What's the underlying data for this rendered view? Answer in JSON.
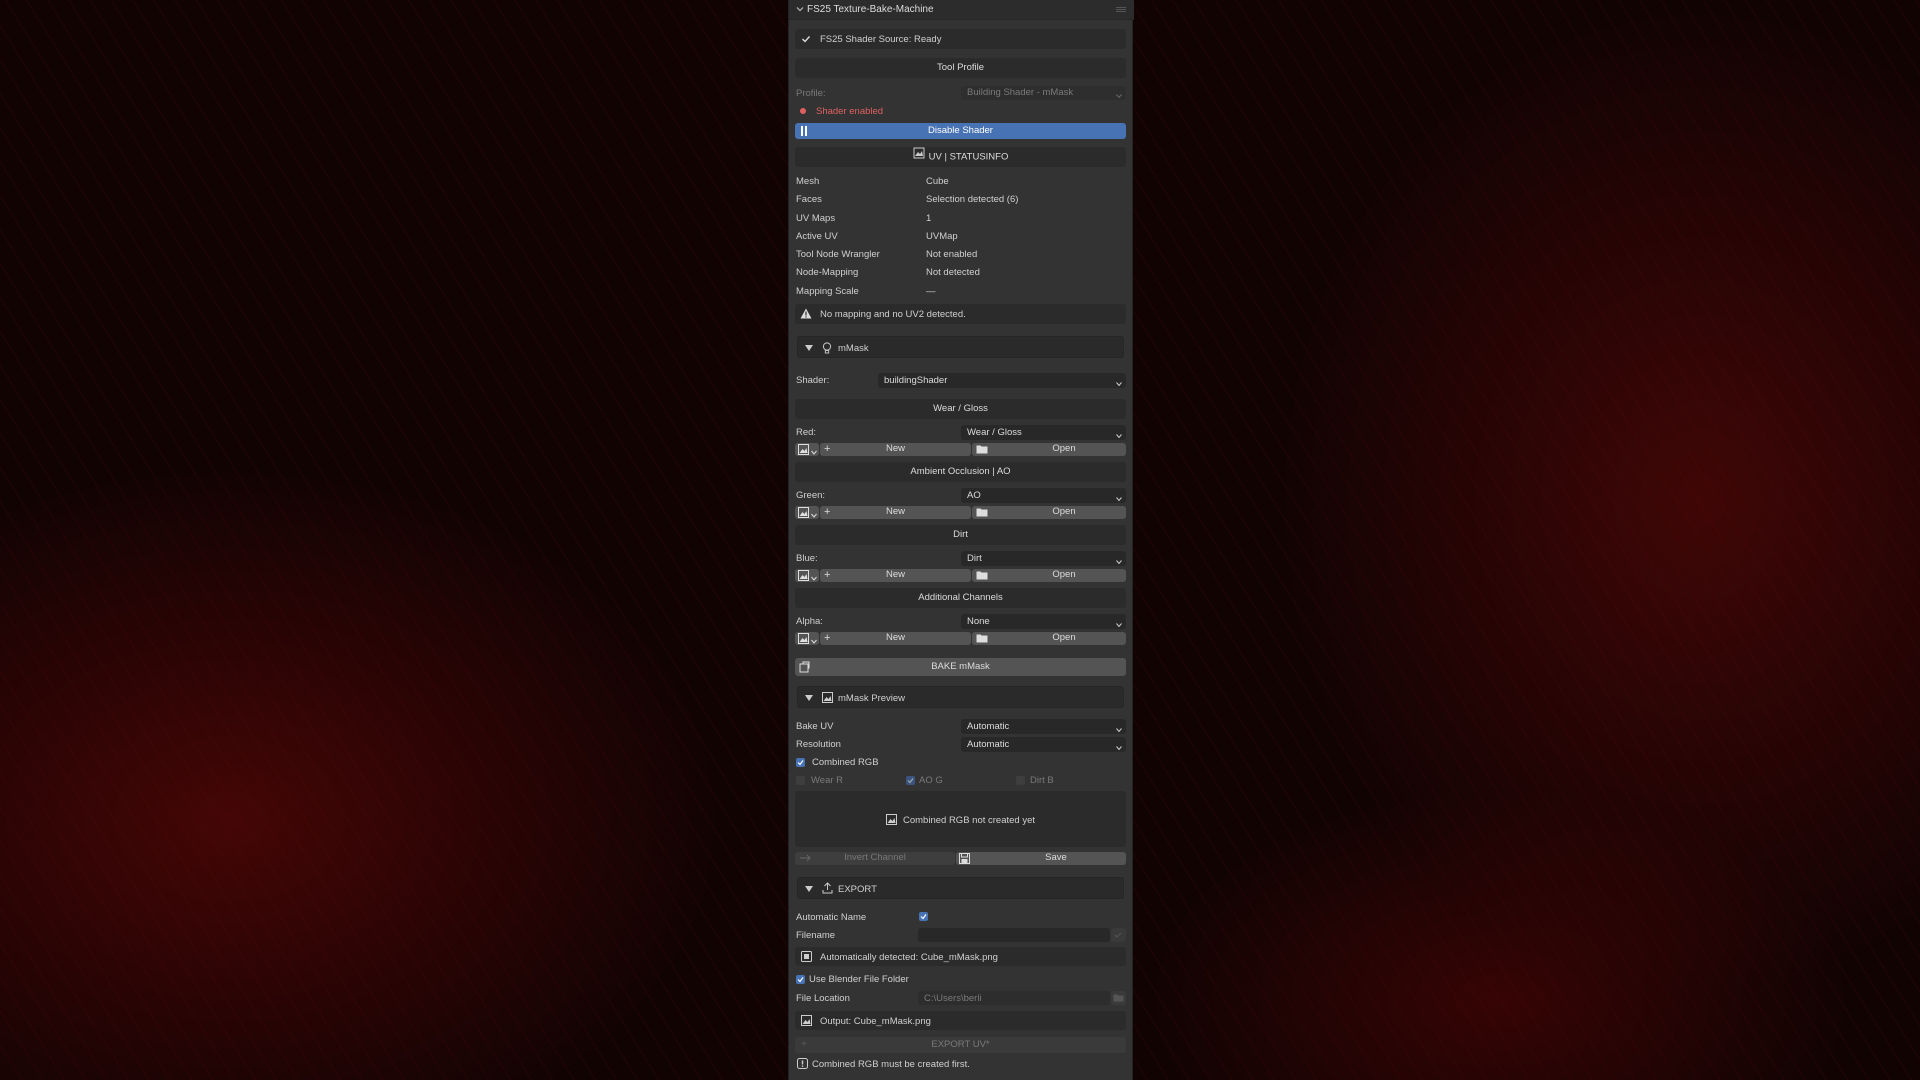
{
  "panel": {
    "title": "FS25 Texture-Bake-Machine",
    "source_status": "FS25 Shader Source: Ready",
    "tool_profile_label": "Tool Profile",
    "profile_label": "Profile:",
    "profile_value": "Building Shader - mMask",
    "shader_status": "Shader enabled",
    "disable_shader_label": "Disable Shader",
    "uv_statusinfo_label": "UV | STATUSINFO"
  },
  "info_rows": [
    {
      "key": "Mesh",
      "value": "Cube"
    },
    {
      "key": "Faces",
      "value": "Selection detected (6)"
    },
    {
      "key": "UV Maps",
      "value": "1"
    },
    {
      "key": "Active UV",
      "value": "UVMap"
    },
    {
      "key": "Tool Node Wrangler",
      "value": "Not enabled"
    },
    {
      "key": "Node-Mapping",
      "value": "Not detected"
    },
    {
      "key": "Mapping Scale",
      "value": "—"
    }
  ],
  "warning": "No mapping and no UV2 detected.",
  "mmask": {
    "section_label": "mMask",
    "shader_label": "Shader:",
    "shader_value": "buildingShader",
    "channels": [
      {
        "header": "Wear / Gloss",
        "label": "Red:",
        "value": "Wear / Gloss",
        "new": "New",
        "open": "Open"
      },
      {
        "header": "Ambient Occlusion | AO",
        "label": "Green:",
        "value": "AO",
        "new": "New",
        "open": "Open"
      },
      {
        "header": "Dirt",
        "label": "Blue:",
        "value": "Dirt",
        "new": "New",
        "open": "Open"
      },
      {
        "header": "Additional Channels",
        "label": "Alpha:",
        "value": "None",
        "new": "New",
        "open": "Open"
      }
    ],
    "bake_label": "BAKE mMask"
  },
  "preview": {
    "section_label": "mMask Preview",
    "bake_uv_label": "Bake UV",
    "bake_uv_value": "Automatic",
    "resolution_label": "Resolution",
    "resolution_value": "Automatic",
    "combined_rgb_label": "Combined RGB",
    "combined_rgb_checked": true,
    "wear_label": "Wear R",
    "ao_label": "AO G",
    "dirt_label": "Dirt B",
    "placeholder_text": "Combined RGB not created yet",
    "invert_label": "Invert Channel",
    "save_label": "Save"
  },
  "export": {
    "section_label": "EXPORT",
    "auto_name_label": "Automatic Name",
    "auto_name_checked": true,
    "filename_label": "Filename",
    "filename_value": "",
    "detected_text": "Automatically detected: Cube_mMask.png",
    "use_blender_folder_label": "Use Blender File Folder",
    "use_blender_folder_checked": true,
    "file_location_label": "File Location",
    "file_location_value": "C:\\Users\\berli",
    "output_text": "Output: Cube_mMask.png",
    "export_uv_label": "EXPORT UV*",
    "footer_note": "Combined RGB must be created first."
  },
  "colors": {
    "panel_bg": "#333333",
    "accent_blue": "#4772b3",
    "status_red": "#e06060",
    "button_gray": "#545454"
  }
}
